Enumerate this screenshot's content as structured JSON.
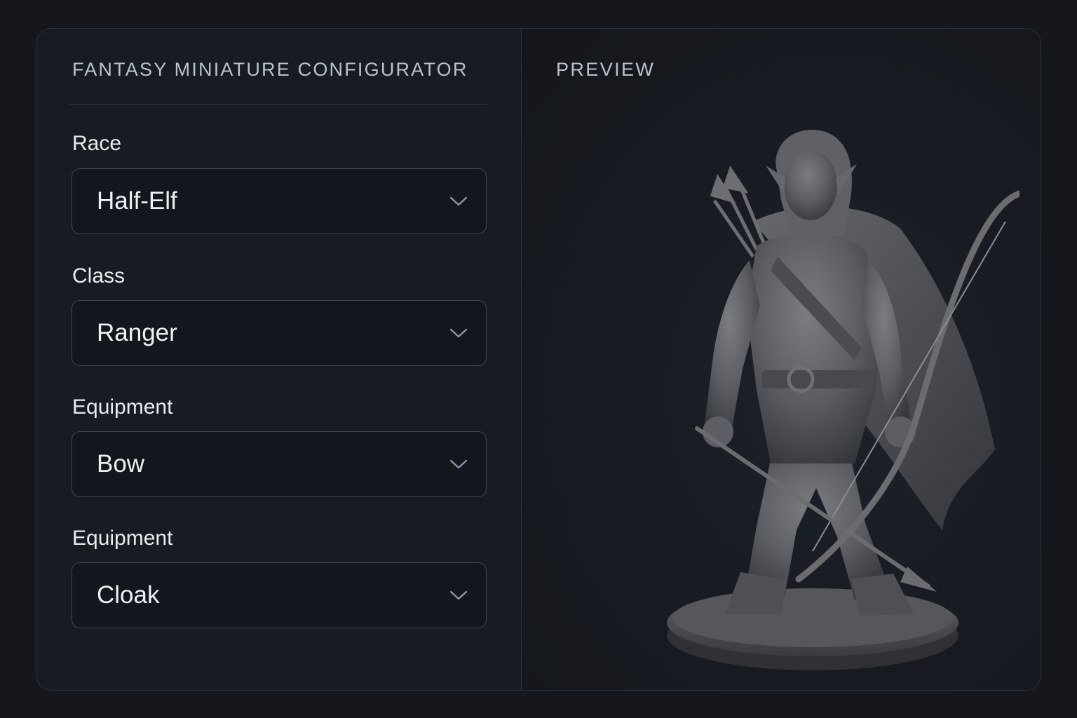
{
  "config": {
    "title": "FANTASY MINIATURE CONFIGURATOR",
    "fields": [
      {
        "label": "Race",
        "value": "Half-Elf"
      },
      {
        "label": "Class",
        "value": "Ranger"
      },
      {
        "label": "Equipment",
        "value": "Bow"
      },
      {
        "label": "Equipment",
        "value": "Cloak"
      }
    ]
  },
  "preview": {
    "title": "PREVIEW",
    "model": "half-elf-ranger-miniature"
  },
  "icons": {
    "dropdown": "chevron-down-icon"
  },
  "colors": {
    "background": "#15171c",
    "panel": "#181b21",
    "border": "#2c323b",
    "field_background": "#13161c",
    "label_text": "#e9ecef",
    "muted_text": "#b9c3cc",
    "miniature": "#5a5c61"
  }
}
